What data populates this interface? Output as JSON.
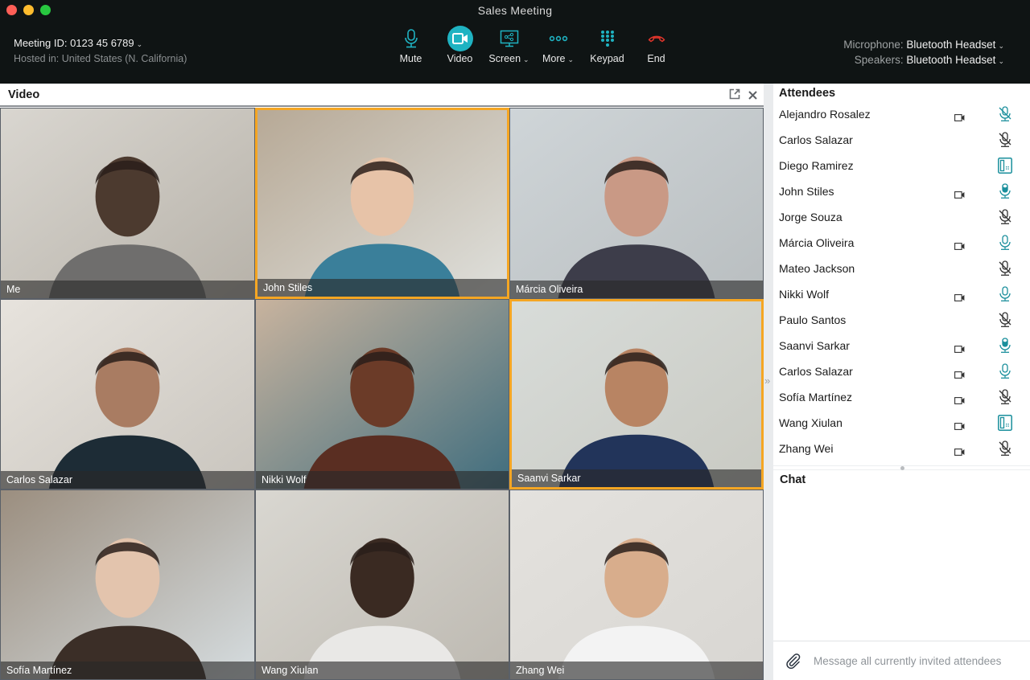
{
  "window": {
    "title": "Sales Meeting"
  },
  "meeting": {
    "id_label": "Meeting ID: 0123 45 6789",
    "hosted_in": "Hosted in: United States (N. California)"
  },
  "controls": [
    {
      "label": "Mute",
      "icon": "microphone-icon"
    },
    {
      "label": "Video",
      "icon": "video-camera-icon",
      "active": true
    },
    {
      "label": "Screen",
      "icon": "screen-share-icon",
      "dropdown": true
    },
    {
      "label": "More",
      "icon": "more-dots-icon",
      "dropdown": true
    },
    {
      "label": "Keypad",
      "icon": "keypad-icon"
    },
    {
      "label": "End",
      "icon": "end-call-icon"
    }
  ],
  "devices": {
    "microphone_key": "Microphone:",
    "microphone_value": "Bluetooth Headset",
    "speakers_key": "Speakers:",
    "speakers_value": "Bluetooth Headset"
  },
  "video_panel": {
    "title": "Video",
    "tiles": [
      {
        "name": "Me",
        "speaking": false
      },
      {
        "name": "John Stiles",
        "speaking": true
      },
      {
        "name": "Márcia Oliveira",
        "speaking": false
      },
      {
        "name": "Carlos Salazar",
        "speaking": false
      },
      {
        "name": "Nikki Wolf",
        "speaking": false
      },
      {
        "name": "Saanvi Sarkar",
        "speaking": true
      },
      {
        "name": "Sofía Martínez",
        "speaking": false
      },
      {
        "name": "Wang Xiulan",
        "speaking": false
      },
      {
        "name": "Zhang Wei",
        "speaking": false
      }
    ]
  },
  "attendees": {
    "title": "Attendees",
    "list": [
      {
        "name": "Alejandro Rosalez",
        "video": true,
        "audio": "muted-active"
      },
      {
        "name": "Carlos Salazar",
        "video": false,
        "audio": "muted"
      },
      {
        "name": "Diego Ramirez",
        "video": false,
        "audio": "phone"
      },
      {
        "name": "John Stiles",
        "video": true,
        "audio": "speaking"
      },
      {
        "name": "Jorge Souza",
        "video": false,
        "audio": "muted"
      },
      {
        "name": "Márcia Oliveira",
        "video": true,
        "audio": "unmuted"
      },
      {
        "name": "Mateo Jackson",
        "video": false,
        "audio": "muted"
      },
      {
        "name": "Nikki Wolf",
        "video": true,
        "audio": "unmuted"
      },
      {
        "name": "Paulo Santos",
        "video": false,
        "audio": "muted"
      },
      {
        "name": "Saanvi Sarkar",
        "video": true,
        "audio": "speaking"
      },
      {
        "name": "Carlos Salazar",
        "video": true,
        "audio": "unmuted"
      },
      {
        "name": "Sofía Martínez",
        "video": true,
        "audio": "muted"
      },
      {
        "name": "Wang Xiulan",
        "video": true,
        "audio": "phone"
      },
      {
        "name": "Zhang Wei",
        "video": true,
        "audio": "muted"
      }
    ]
  },
  "chat": {
    "title": "Chat",
    "placeholder": "Message all currently invited attendees"
  },
  "colors": {
    "accent": "#1fb3c2",
    "speaking_border": "#f5a623",
    "end_call": "#e0352b",
    "titlebar_bg": "#0f1414"
  }
}
